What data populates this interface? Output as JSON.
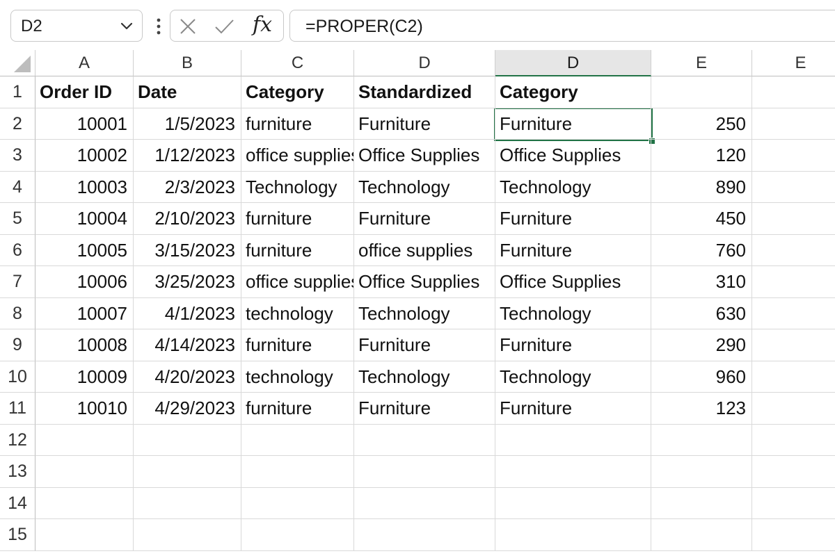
{
  "name_box": "D2",
  "formula": "=PROPER(C2)",
  "icons": {
    "namebox_dropdown": "chevron-down-icon",
    "more": "vertical-dots-icon",
    "cancel": "x-icon",
    "enter": "check-icon",
    "function": "fx-icon"
  },
  "fx_label": "fx",
  "columns": [
    "A",
    "B",
    "C",
    "D",
    "D",
    "E",
    "E"
  ],
  "rows": [
    "1",
    "2",
    "3",
    "4",
    "5",
    "6",
    "7",
    "8",
    "9",
    "10",
    "11",
    "12",
    "13",
    "14",
    "15"
  ],
  "data": [
    [
      "Order ID",
      "Date",
      "Category",
      "Standardized",
      "Category",
      "",
      ""
    ],
    [
      "10001",
      "1/5/2023",
      "furniture",
      "Furniture",
      "Furniture",
      "250",
      ""
    ],
    [
      "10002",
      "1/12/2023",
      "office supplies",
      "Office Supplies",
      "Office Supplies",
      "120",
      ""
    ],
    [
      "10003",
      "2/3/2023",
      "Technology",
      "Technology",
      "Technology",
      "890",
      ""
    ],
    [
      "10004",
      "2/10/2023",
      "furniture",
      "Furniture",
      "Furniture",
      "450",
      ""
    ],
    [
      "10005",
      "3/15/2023",
      "furniture",
      "office supplies",
      "Furniture",
      "760",
      ""
    ],
    [
      "10006",
      "3/25/2023",
      "office supplies",
      "Office Supplies",
      "Office Supplies",
      "310",
      ""
    ],
    [
      "10007",
      "4/1/2023",
      "technology",
      "Technology",
      "Technology",
      "630",
      ""
    ],
    [
      "10008",
      "4/14/2023",
      "furniture",
      "Furniture",
      "Furniture",
      "290",
      ""
    ],
    [
      "10009",
      "4/20/2023",
      "technology",
      "Technology",
      "Technology",
      "960",
      ""
    ],
    [
      "10010",
      "4/29/2023",
      "furniture",
      "Furniture",
      "Furniture",
      "123",
      ""
    ],
    [
      "",
      "",
      "",
      "",
      "",
      "",
      ""
    ],
    [
      "",
      "",
      "",
      "",
      "",
      "",
      ""
    ],
    [
      "",
      "",
      "",
      "",
      "",
      "",
      ""
    ],
    [
      "",
      "",
      "",
      "",
      "",
      "",
      ""
    ]
  ],
  "selected_cell": "D2",
  "accent_color": "#217346"
}
